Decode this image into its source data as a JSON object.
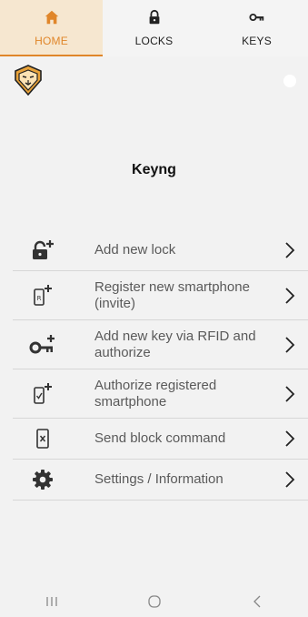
{
  "tabs": [
    {
      "label": "HOME",
      "icon": "home-icon",
      "active": true
    },
    {
      "label": "LOCKS",
      "icon": "lock-icon",
      "active": false
    },
    {
      "label": "KEYS",
      "icon": "key-icon",
      "active": false
    }
  ],
  "app": {
    "title": "Keyng",
    "logo_icon": "lion-logo-icon"
  },
  "menu": {
    "items": [
      {
        "label": "Add new lock",
        "icon": "lock-plus-icon"
      },
      {
        "label": "Register new smartphone (invite)",
        "icon": "smartphone-plus-icon"
      },
      {
        "label": "Add new key via RFID and authorize",
        "icon": "key-plus-icon"
      },
      {
        "label": "Authorize registered smartphone",
        "icon": "smartphone-check-plus-icon"
      },
      {
        "label": "Send block command",
        "icon": "smartphone-block-icon"
      },
      {
        "label": "Settings / Information",
        "icon": "gear-icon"
      }
    ]
  },
  "navbar": {
    "recent": "recents-icon",
    "home": "home-circle-icon",
    "back": "back-icon"
  },
  "colors": {
    "accent": "#e0862a",
    "tab_active_bg": "#f6e7d0",
    "icon_dark": "#333333",
    "text_muted": "#5a5a5a",
    "background": "#f2f2f2"
  }
}
